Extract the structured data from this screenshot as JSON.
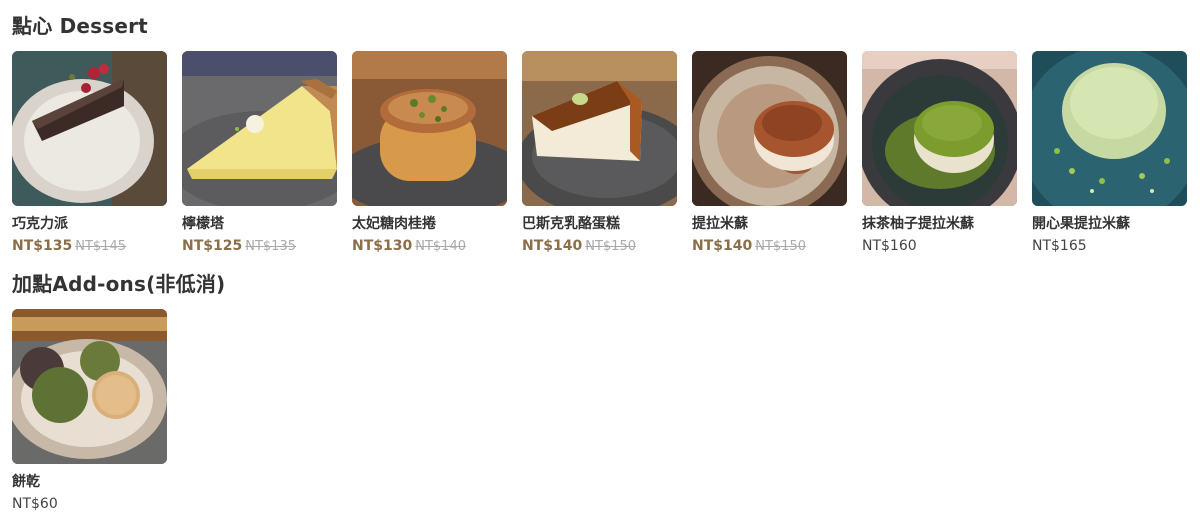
{
  "sections": [
    {
      "title": "點心 Dessert",
      "items": [
        {
          "name": "巧克力派",
          "price": "NT$135",
          "original": "NT$145",
          "on_sale": true,
          "image": "chocolate-tart-image"
        },
        {
          "name": "檸檬塔",
          "price": "NT$125",
          "original": "NT$135",
          "on_sale": true,
          "image": "lemon-tart-image"
        },
        {
          "name": "太妃糖肉桂捲",
          "price": "NT$130",
          "original": "NT$140",
          "on_sale": true,
          "image": "toffee-cinnamon-roll-image"
        },
        {
          "name": "巴斯克乳酪蛋糕",
          "price": "NT$140",
          "original": "NT$150",
          "on_sale": true,
          "image": "basque-cheesecake-image"
        },
        {
          "name": "提拉米蘇",
          "price": "NT$140",
          "original": "NT$150",
          "on_sale": true,
          "image": "tiramisu-image"
        },
        {
          "name": "抹茶柚子提拉米蘇",
          "price": "NT$160",
          "on_sale": false,
          "image": "matcha-yuzu-tiramisu-image"
        },
        {
          "name": "開心果提拉米蘇",
          "price": "NT$165",
          "on_sale": false,
          "image": "pistachio-tiramisu-image"
        }
      ]
    },
    {
      "title": "加點Add-ons(非低消)",
      "items": [
        {
          "name": "餅乾",
          "price": "NT$60",
          "on_sale": false,
          "image": "cookies-image"
        }
      ]
    }
  ],
  "colors": {
    "sale_price": "#8a6f4a",
    "original_price": "#aaaaaa",
    "regular_price": "#444444",
    "heading": "#333333"
  }
}
